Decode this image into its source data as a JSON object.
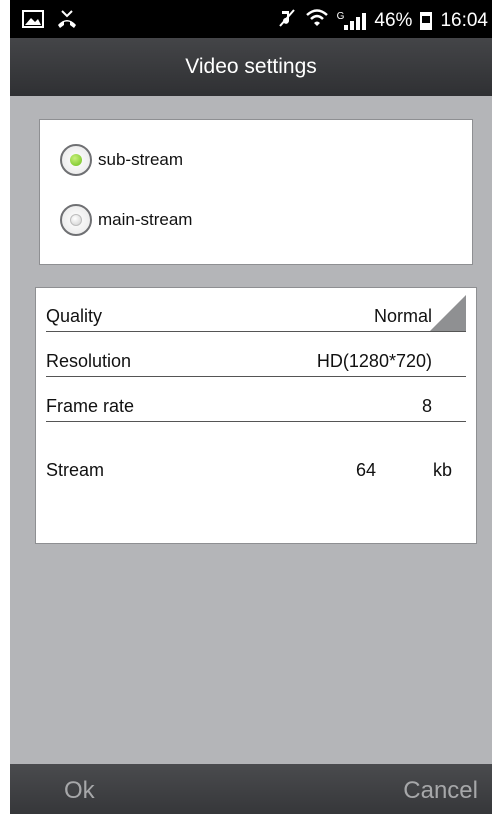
{
  "status_bar": {
    "battery_percent": "46%",
    "time": "16:04",
    "network_type": "G",
    "icons": [
      "image-icon",
      "missed-call-icon",
      "mute-icon",
      "wifi-icon",
      "signal-icon",
      "battery-icon"
    ]
  },
  "title": "Video settings",
  "stream": {
    "options": [
      {
        "label": "sub-stream",
        "selected": true
      },
      {
        "label": "main-stream",
        "selected": false
      }
    ]
  },
  "settings": {
    "quality_label": "Quality",
    "quality_value": "Normal",
    "resolution_label": "Resolution",
    "resolution_value": "HD(1280*720)",
    "frame_rate_label": "Frame rate",
    "frame_rate_value": "8",
    "stream_label": "Stream",
    "stream_value": "64",
    "stream_unit": "kb"
  },
  "buttons": {
    "ok": "Ok",
    "cancel": "Cancel"
  },
  "colors": {
    "background": "#b4b5b8",
    "selected_radio": "#6cbf1c",
    "title_bar": "#3a3b3e"
  }
}
